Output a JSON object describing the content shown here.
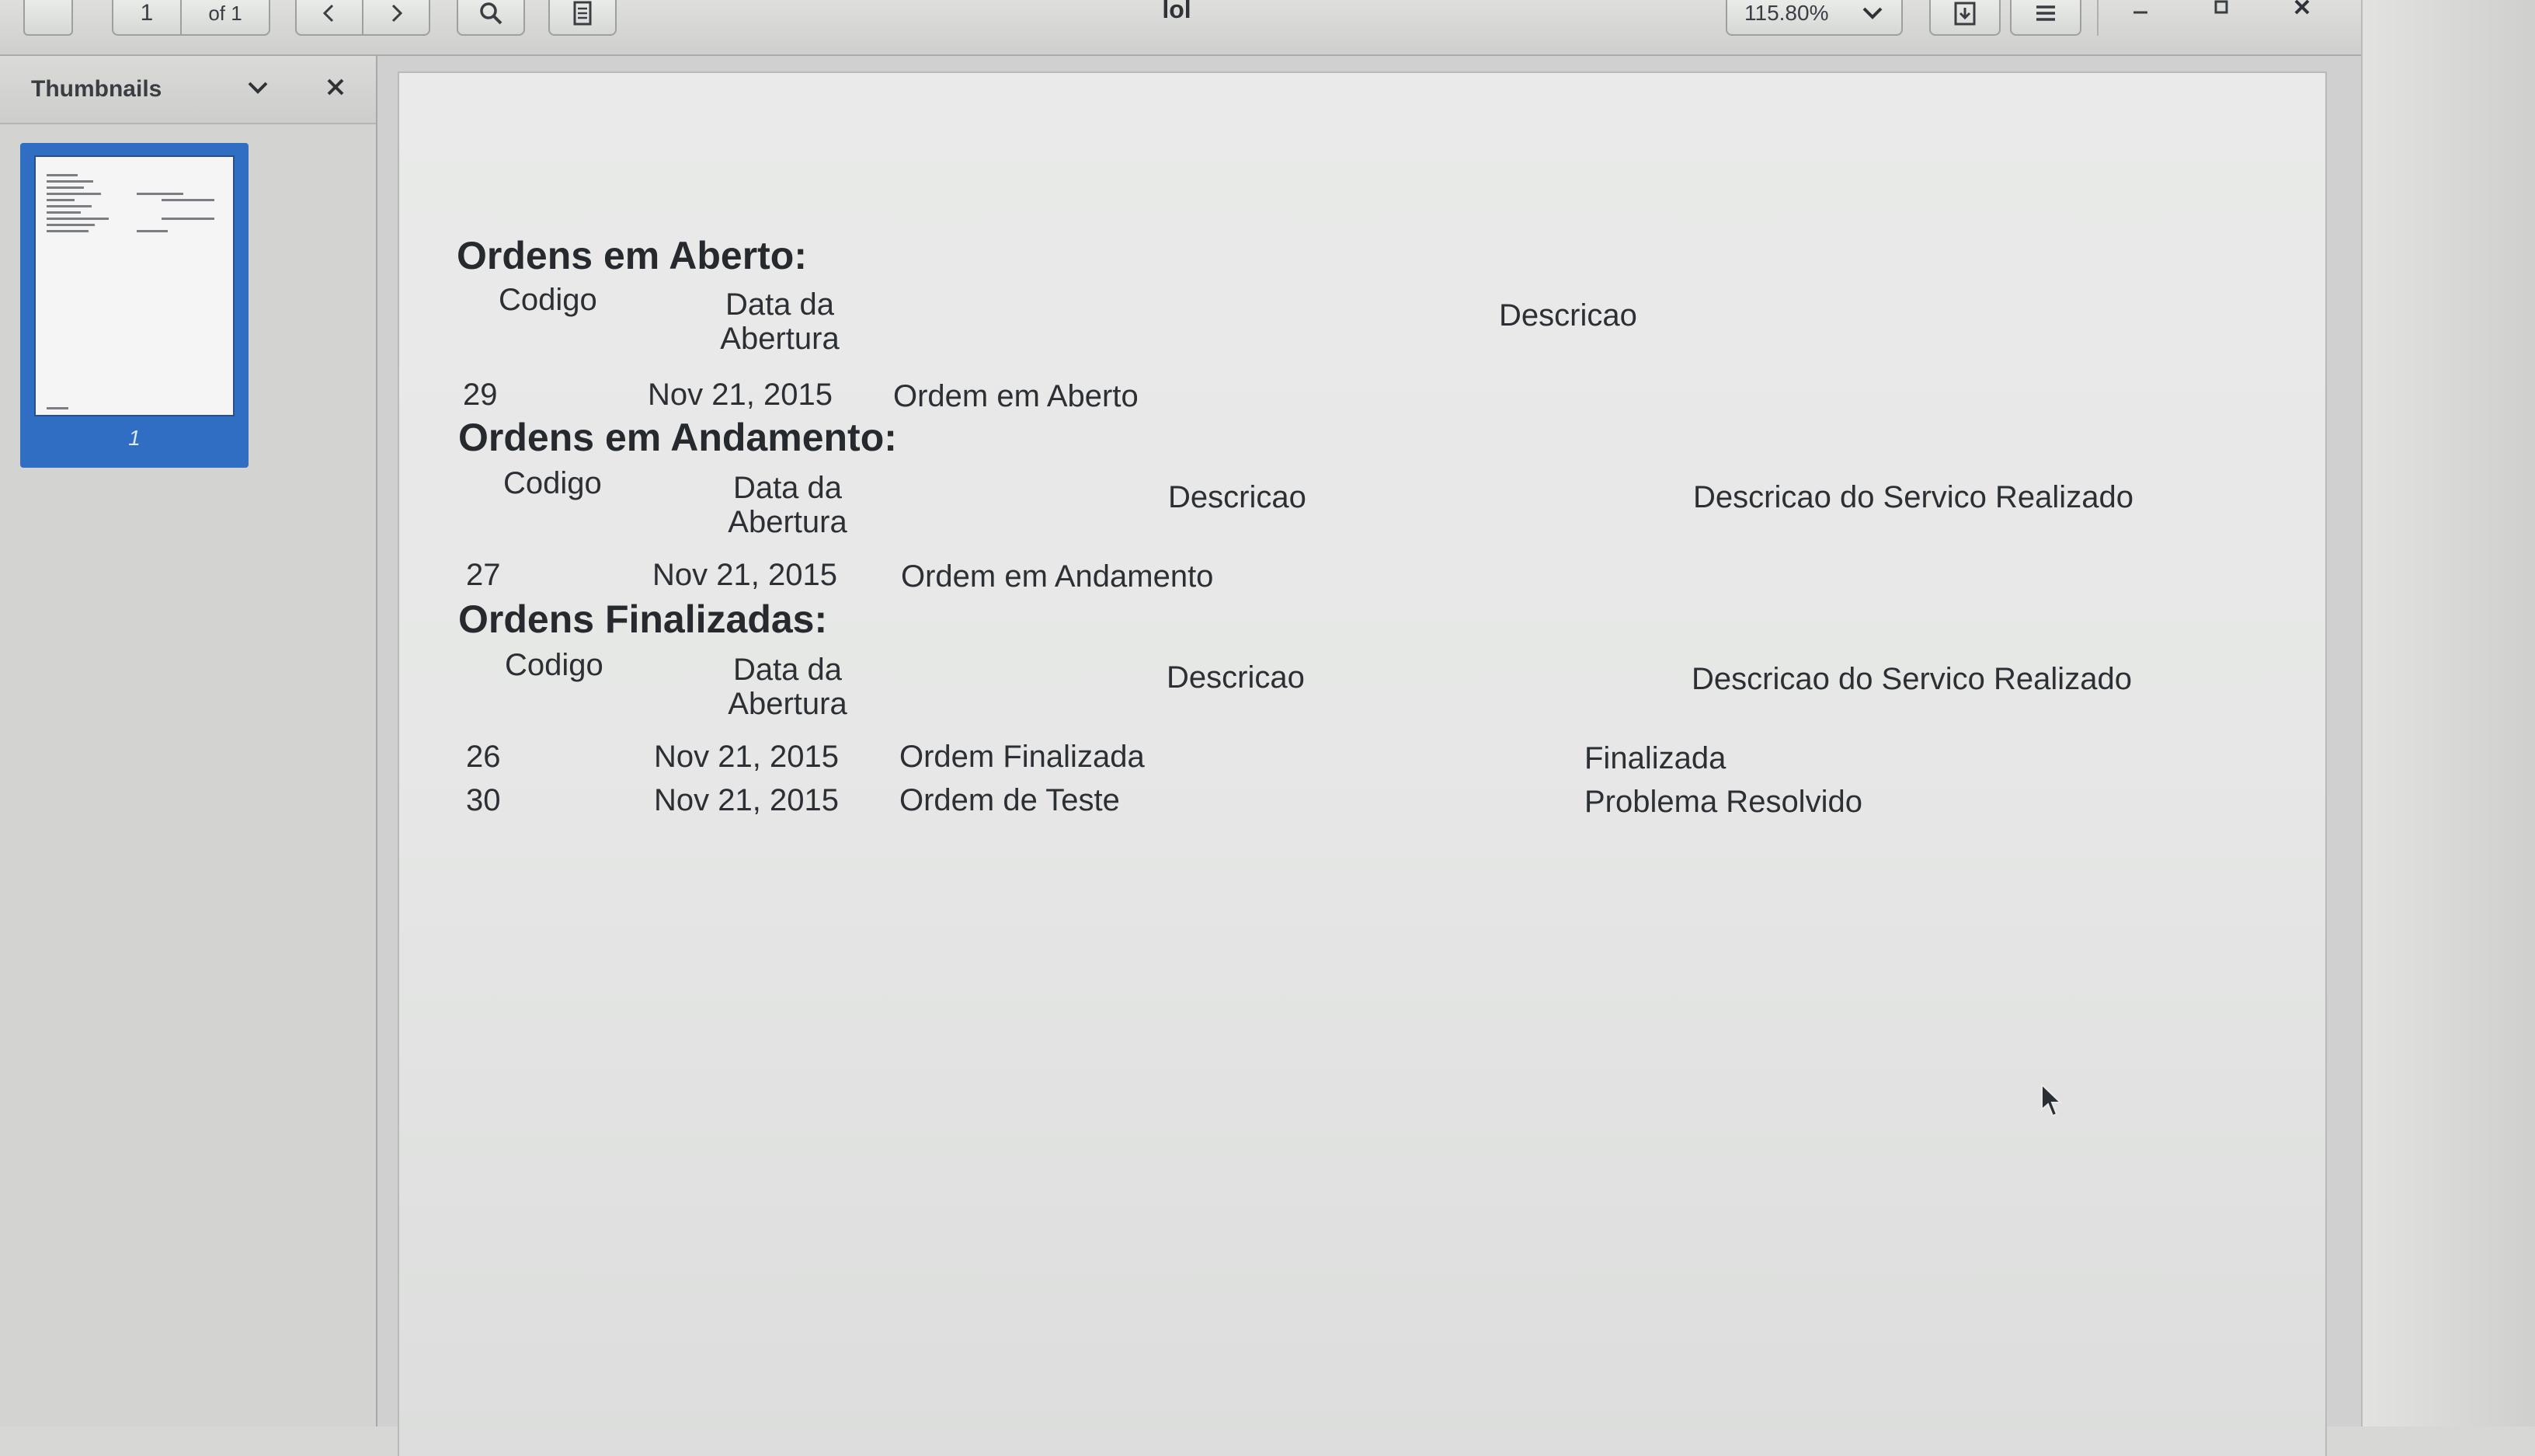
{
  "toolbar": {
    "page_number": "1",
    "page_count": "of 1",
    "document_title": "lol",
    "zoom": "115.80%"
  },
  "sidebar": {
    "title": "Thumbnails",
    "thumbnails": [
      {
        "label": "1"
      }
    ]
  },
  "document": {
    "sections": [
      {
        "title": "Ordens em Aberto:",
        "headers": {
          "codigo": "Codigo",
          "data": "Data da Abertura",
          "descricao": "Descricao"
        },
        "rows": [
          {
            "codigo": "29",
            "data": "Nov 21, 2015",
            "descricao": "Ordem em Aberto"
          }
        ]
      },
      {
        "title": "Ordens em Andamento:",
        "headers": {
          "codigo": "Codigo",
          "data": "Data da Abertura",
          "descricao": "Descricao",
          "servico": "Descricao do Servico Realizado"
        },
        "rows": [
          {
            "codigo": "27",
            "data": "Nov 21, 2015",
            "descricao": "Ordem em Andamento",
            "servico": ""
          }
        ]
      },
      {
        "title": "Ordens Finalizadas:",
        "headers": {
          "codigo": "Codigo",
          "data": "Data da Abertura",
          "descricao": "Descricao",
          "servico": "Descricao do Servico Realizado"
        },
        "rows": [
          {
            "codigo": "26",
            "data": "Nov 21, 2015",
            "descricao": "Ordem Finalizada",
            "servico": "Finalizada"
          },
          {
            "codigo": "30",
            "data": "Nov 21, 2015",
            "descricao": "Ordem de Teste",
            "servico": "Problema Resolvido"
          }
        ]
      }
    ]
  },
  "icons": {
    "prev": "chevron-left-icon",
    "next": "chevron-right-icon",
    "search": "search-icon",
    "annotations": "document-icon",
    "save": "save-icon",
    "menu": "hamburger-menu-icon",
    "minimize": "minimize-icon",
    "maximize": "maximize-icon",
    "close": "close-icon",
    "sidebar_dropdown": "chevron-down-icon",
    "sidebar_close": "close-icon",
    "cursor": "mouse-pointer-icon"
  },
  "colors": {
    "thumbnail_selection": "#2f6ec2",
    "page_background": "#e9eae9"
  }
}
